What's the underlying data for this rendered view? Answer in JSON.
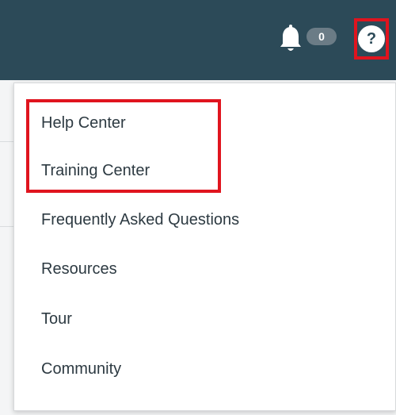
{
  "header": {
    "notifications": {
      "icon": "bell-icon",
      "count": "0"
    },
    "help": {
      "icon": "question-mark-icon",
      "label": "?"
    }
  },
  "help_menu": {
    "items": [
      {
        "label": "Help Center"
      },
      {
        "label": "Training Center"
      },
      {
        "label": "Frequently Asked Questions"
      },
      {
        "label": "Resources"
      },
      {
        "label": "Tour"
      },
      {
        "label": "Community"
      }
    ]
  },
  "colors": {
    "topbar": "#2c4a58",
    "highlight": "#e0141e",
    "badge": "#6b7c86",
    "menu_text": "#2d3a42"
  }
}
